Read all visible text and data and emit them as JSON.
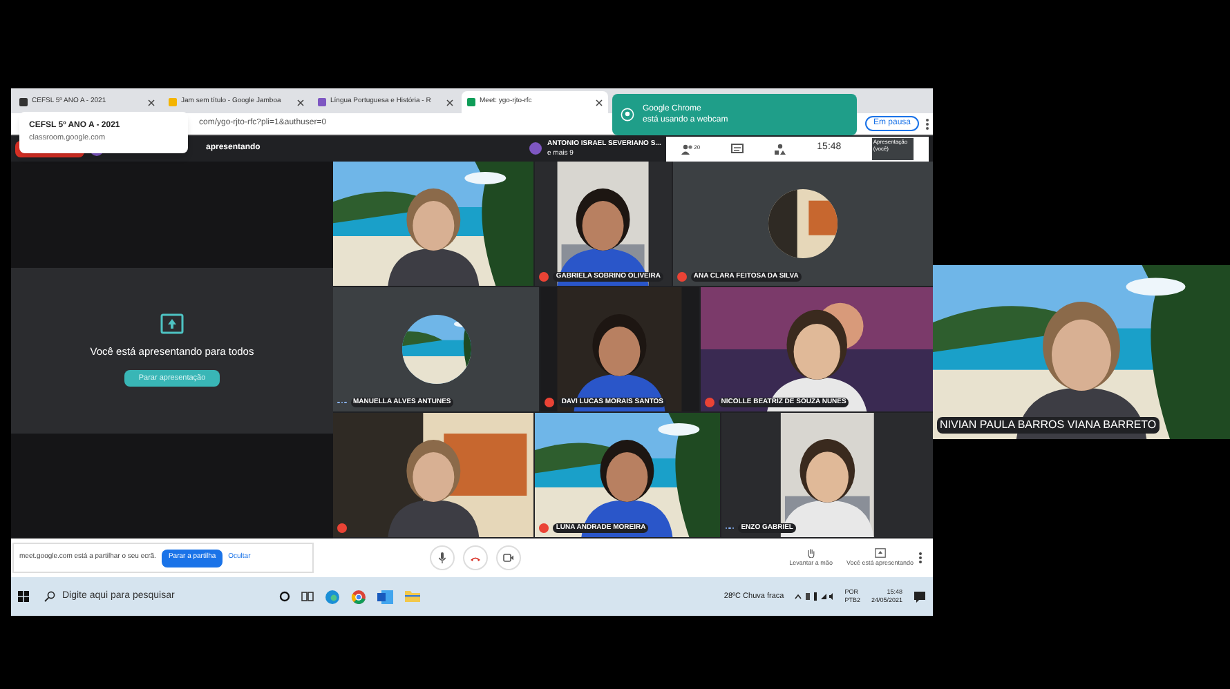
{
  "browser": {
    "tabs": [
      {
        "title": "CEFSL 5º ANO A - 2021",
        "selected": false
      },
      {
        "title": "Jam sem título - Google Jamboa",
        "selected": false
      },
      {
        "title": "Língua Portuguesa e História - R",
        "selected": false
      },
      {
        "title": "Meet: ygo-rjto-rfc",
        "selected": true
      }
    ],
    "tooltip": {
      "title": "CEFSL 5º ANO A - 2021",
      "subtitle": "classroom.google.com"
    },
    "address": "com/ygo-rjto-rfc?pli=1&authuser=0",
    "paused_button": "Em pausa",
    "notification": {
      "title": "Google Chrome",
      "message": "está usando a webcam"
    }
  },
  "meet": {
    "header": {
      "presenting": "apresentando",
      "speaker": "ANTONIO ISRAEL SEVERIANO S...",
      "others": "e mais 9",
      "participant_count": "20",
      "time": "15:48",
      "self_label": "Apresentação (você)"
    },
    "presenting_panel": {
      "message": "Você está apresentando para todos",
      "button": "Parar apresentação"
    },
    "tiles": [
      [
        {
          "kind": "video"
        },
        {
          "kind": "video",
          "name": "GABRIELA SOBRINO OLIVEIRA",
          "muted": true
        },
        {
          "kind": "avatar",
          "name": "ANA CLARA FEITOSA DA SILVA",
          "muted": true
        }
      ],
      [
        {
          "kind": "avatar",
          "name": "MANUELLA ALVES ANTUNES",
          "muted": false
        },
        {
          "kind": "video",
          "name": "DAVI LUCAS MORAIS SANTOS",
          "muted": true
        },
        {
          "kind": "video",
          "name": "NICOLLE BEATRIZ DE SOUZA NUNES",
          "muted": true
        }
      ],
      [
        {
          "kind": "video",
          "muted": true
        },
        {
          "kind": "video",
          "name": "LUNA ANDRADE MOREIRA",
          "muted": true
        },
        {
          "kind": "video",
          "name": "ENZO GABRIEL",
          "muted": false
        }
      ]
    ],
    "share_bar": {
      "message": "meet.google.com está a partilhar o seu ecrã.",
      "stop_button": "Parar a partilha",
      "hide_button": "Ocultar"
    },
    "actions": [
      {
        "label": "Levantar a mão"
      },
      {
        "label": "Você está apresentando"
      }
    ]
  },
  "taskbar": {
    "search_placeholder": "Digite aqui para pesquisar",
    "weather": "28ºC  Chuva fraca",
    "language": "POR",
    "layout": "PTB2",
    "time": "15:48",
    "date": "24/05/2021"
  },
  "side_video": {
    "name": "NIVIAN PAULA BARROS VIANA BARRETO"
  }
}
